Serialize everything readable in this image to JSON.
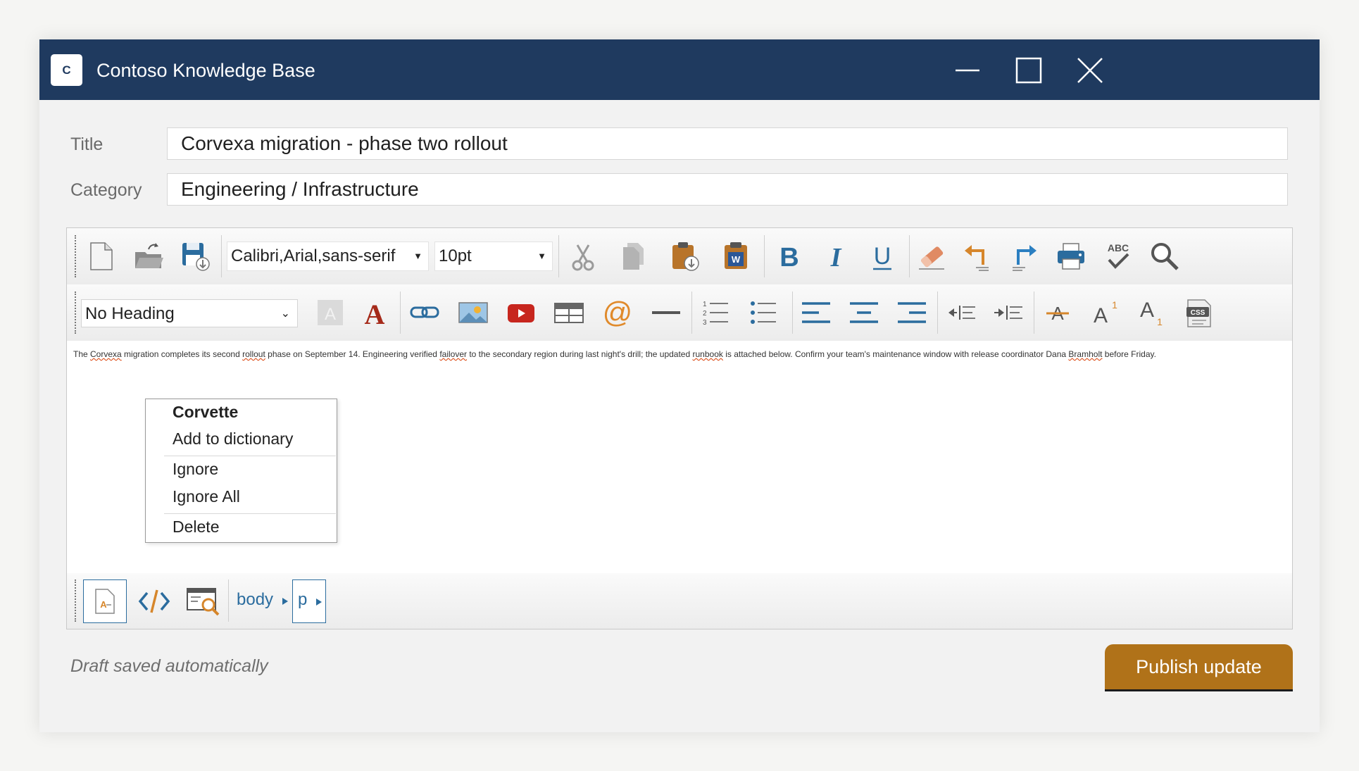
{
  "window": {
    "app_icon_letter": "C",
    "title": "Contoso Knowledge Base",
    "title_bar_color": "#1f3a5f"
  },
  "form": {
    "title_label": "Title",
    "title_value": "Corvexa migration - phase two rollout",
    "category_label": "Category",
    "category_value": "Engineering / Infrastructure"
  },
  "toolbar": {
    "font_family": "Calibri,Arial,sans-serif",
    "font_size": "10pt",
    "heading": "No Heading",
    "icons_row1": [
      "new-document-icon",
      "open-folder-icon",
      "save-icon",
      "cut-icon",
      "copy-icon",
      "paste-icon",
      "paste-from-word-icon",
      "bold-icon",
      "italic-icon",
      "underline-icon",
      "eraser-icon",
      "undo-icon",
      "redo-icon",
      "print-icon",
      "spellcheck-icon",
      "search-icon"
    ],
    "icons_row2": [
      "font-background-color-icon",
      "font-color-icon",
      "link-icon",
      "image-icon",
      "video-icon",
      "table-icon",
      "at-mention-icon",
      "horizontal-rule-icon",
      "numbered-list-icon",
      "bulleted-list-icon",
      "align-left-icon",
      "align-center-icon",
      "align-right-icon",
      "outdent-icon",
      "indent-icon",
      "strikethrough-icon",
      "superscript-icon",
      "subscript-icon",
      "css-icon"
    ]
  },
  "editor": {
    "p1": "The ",
    "w1": "Corvexa",
    "p2": " migration completes its second ",
    "w2": "rollout",
    "p3": " phase on September 14. Engineering verified ",
    "w3": "failover",
    "p4": " to the secondary region during last night's drill; the updated ",
    "w4": "runbook",
    "p5": " is attached below. Confirm your team's maintenance window with release coordinator Dana ",
    "w5": "Bramholt",
    "p6": " before Friday."
  },
  "context_menu": {
    "suggestion": "Corvette",
    "add_to_dictionary": "Add to dictionary",
    "ignore": "Ignore",
    "ignore_all": "Ignore All",
    "delete": "Delete"
  },
  "status_bar": {
    "crumbs": [
      "body",
      "p"
    ]
  },
  "footer": {
    "draft_status": "Draft saved automatically",
    "publish_label": "Publish update",
    "accent": "#b07219"
  }
}
